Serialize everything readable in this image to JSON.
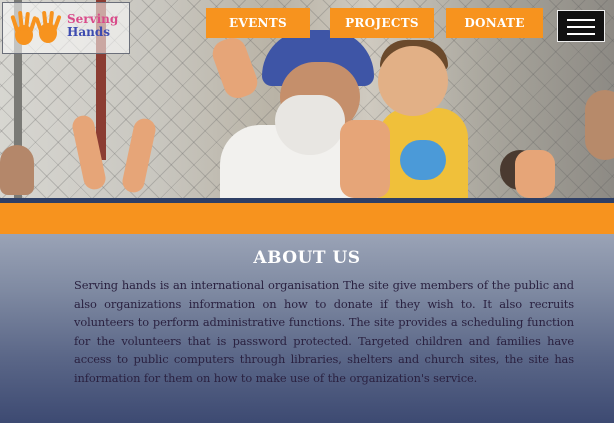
{
  "brand": {
    "line1": "Serving",
    "line2": "Hands",
    "logo_icon": "waving-hands-icon"
  },
  "nav": {
    "events": "EVENTS",
    "projects": "PROJECTS",
    "donate": "DONATE",
    "menu_icon": "hamburger-menu-icon"
  },
  "colors": {
    "accent": "#f7931e",
    "navy": "#2e3f66",
    "logo_pink": "#d94b8a",
    "logo_blue": "#3c4bb0"
  },
  "about": {
    "title": "ABOUT US",
    "body": "Serving hands is an international organisation The site give members of the public and also organizations information on how to donate if they wish to. It also recruits volunteers to perform administrative functions. The site provides a scheduling function for the volunteers that is password protected. Targeted children and families have access to public computers through libraries, shelters and church sites, the site has information for them on how to make use of the organization's service."
  }
}
